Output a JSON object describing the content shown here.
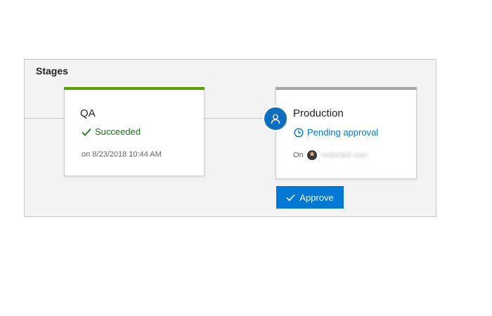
{
  "panel": {
    "title": "Stages"
  },
  "stages": [
    {
      "name": "QA",
      "status": "Succeeded",
      "status_color": "#107c10",
      "bar_color": "#57a300",
      "status_icon": "checkmark-icon",
      "meta": "on 8/23/2018 10:44 AM"
    },
    {
      "name": "Production",
      "status": "Pending approval",
      "status_color": "#0078d4",
      "bar_color": "#a6a6a6",
      "status_icon": "clock-icon",
      "meta_prefix": "On",
      "approver_name": "redacted user",
      "approver_icon": "person-icon"
    }
  ],
  "approve_button": {
    "label": "Approve",
    "color": "#0078d4",
    "icon": "checkmark-icon"
  }
}
